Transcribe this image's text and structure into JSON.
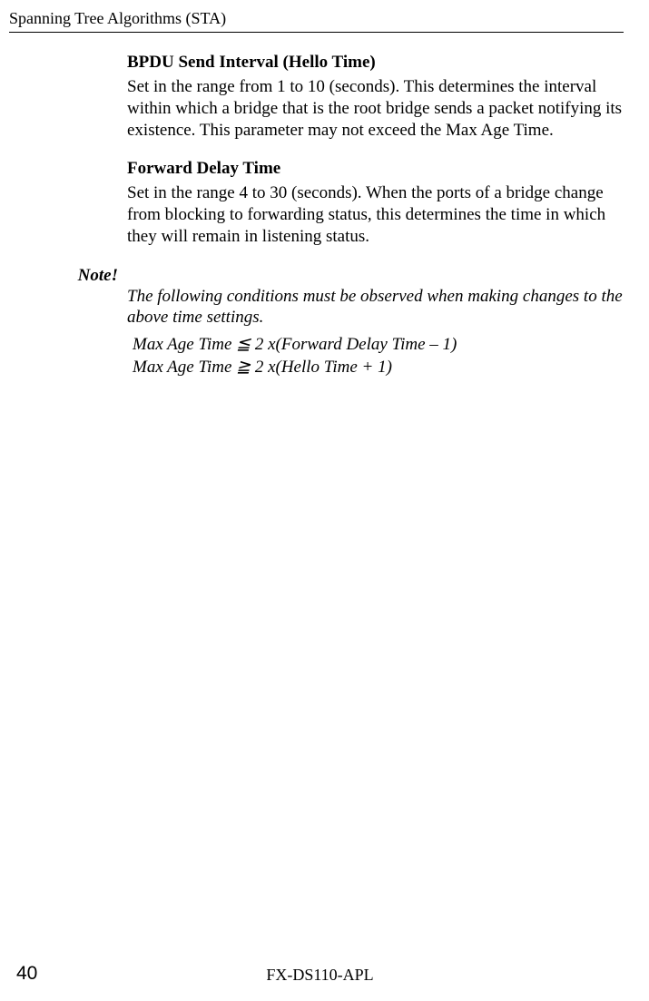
{
  "header": "Spanning Tree Algorithms (STA)",
  "section1": {
    "heading": "BPDU Send Interval (Hello Time)",
    "body": "Set in the range from 1 to 10 (seconds).   This determines the interval within which a bridge that is the root bridge sends a packet notifying its existence.   This parameter may not exceed the Max Age Time."
  },
  "section2": {
    "heading": "Forward Delay Time",
    "body": "Set in the range 4 to 30 (seconds).   When the ports of a bridge change from blocking to forwarding status, this determines the time in which they will remain in listening status."
  },
  "note": {
    "label": "Note!",
    "body": "The following conditions must be observed when making changes to the above time settings.",
    "cond1": "Max Age Time ≦ 2 x(Forward Delay Time – 1)",
    "cond2": "Max Age Time ≧ 2 x(Hello Time + 1)"
  },
  "footer": {
    "page": "40",
    "center": "FX-DS110-APL"
  }
}
